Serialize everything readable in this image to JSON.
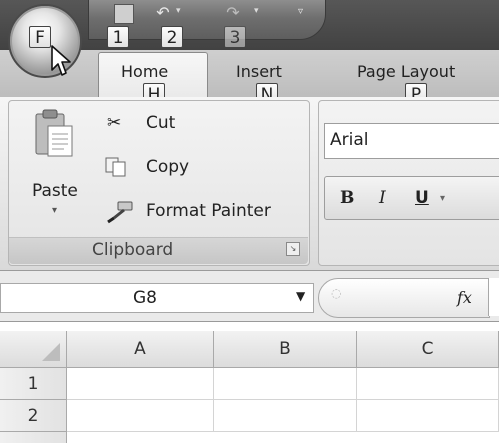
{
  "quick_access": {
    "save_icon": "save-icon",
    "undo_icon": "undo-icon",
    "redo_icon": "redo-icon",
    "customize_glyph": "▿"
  },
  "keytips": {
    "office": "F",
    "qat_1": "1",
    "qat_2": "2",
    "qat_3": "3",
    "home": "H",
    "insert": "N",
    "page_layout": "P"
  },
  "tabs": [
    {
      "label": "Home",
      "active": true
    },
    {
      "label": "Insert",
      "active": false
    },
    {
      "label": "Page Layout",
      "active": false
    }
  ],
  "clipboard": {
    "paste_label": "Paste",
    "cut_label": "Cut",
    "copy_label": "Copy",
    "format_painter_label": "Format Painter",
    "group_title": "Clipboard"
  },
  "font_group": {
    "font_name": "Arial",
    "bold": "B",
    "italic": "I",
    "underline": "U"
  },
  "formula_bar": {
    "name_box_value": "G8",
    "fx_label": "fx",
    "formula_value": ""
  },
  "sheet": {
    "columns": [
      "A",
      "B",
      "C"
    ],
    "rows": [
      "1",
      "2"
    ]
  },
  "colors": {
    "titlebar": "#4a4a4a",
    "ribbon": "#e6e6e6",
    "active_tab": "#f4f4f4"
  }
}
